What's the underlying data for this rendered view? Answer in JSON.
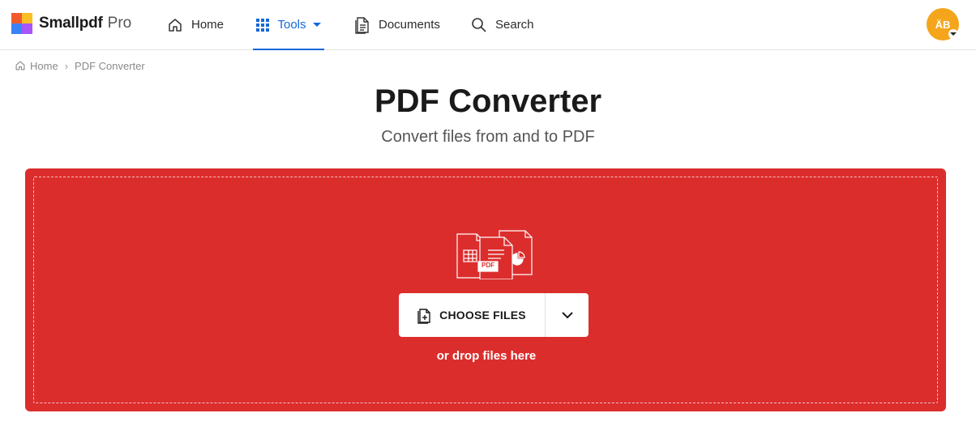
{
  "brand": {
    "name": "Smallpdf",
    "tier": "Pro",
    "colors": [
      "#f25a2b",
      "#fbbf24",
      "#22c55e",
      "#3b82f6",
      "#ef4444",
      "#a855f7"
    ]
  },
  "nav": {
    "home": "Home",
    "tools": "Tools",
    "documents": "Documents",
    "search": "Search",
    "active_color": "#1468d8"
  },
  "user": {
    "initials": "ÄB",
    "avatar_color": "#f4a51c"
  },
  "breadcrumb": {
    "home": "Home",
    "separator": "›",
    "current": "PDF Converter"
  },
  "page": {
    "title": "PDF Converter",
    "subtitle": "Convert files from and to PDF"
  },
  "dropzone": {
    "background": "#dc2d2d",
    "illustration_badge": "PDF",
    "choose_label": "CHOOSE FILES",
    "drop_hint": "or drop files here"
  }
}
